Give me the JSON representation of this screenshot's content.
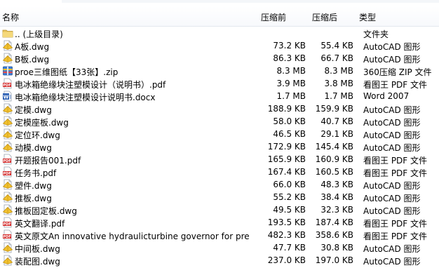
{
  "header": {
    "name": "名称",
    "size_before": "压缩前",
    "size_after": "压缩后",
    "type": "类型"
  },
  "files": [
    {
      "name": ".. (上级目录)",
      "icon": "folder-up-icon",
      "before": "",
      "after": "",
      "type": "文件夹"
    },
    {
      "name": "A板.dwg",
      "icon": "dwg-icon",
      "before": "73.2 KB",
      "after": "55.4 KB",
      "type": "AutoCAD 图形"
    },
    {
      "name": "B板.dwg",
      "icon": "dwg-icon",
      "before": "86.3 KB",
      "after": "66.7 KB",
      "type": "AutoCAD 图形"
    },
    {
      "name": "proe三维图纸【33张】.zip",
      "icon": "zip-icon",
      "before": "8.3 MB",
      "after": "8.3 MB",
      "type": "360压缩 ZIP 文件"
    },
    {
      "name": "电冰箱绝缘块注塑模设计（说明书）.pdf",
      "icon": "pdf-icon",
      "before": "3.9 MB",
      "after": "3.8 MB",
      "type": "看图王 PDF 文件"
    },
    {
      "name": "电冰箱绝缘块注塑模设计说明书.docx",
      "icon": "docx-icon",
      "before": "1.7 MB",
      "after": "1.7 MB",
      "type": "Word 2007"
    },
    {
      "name": "定模.dwg",
      "icon": "dwg-icon",
      "before": "188.9 KB",
      "after": "159.9 KB",
      "type": "AutoCAD 图形"
    },
    {
      "name": "定模座板.dwg",
      "icon": "dwg-icon",
      "before": "58.0 KB",
      "after": "40.7 KB",
      "type": "AutoCAD 图形"
    },
    {
      "name": "定位环.dwg",
      "icon": "dwg-icon",
      "before": "46.5 KB",
      "after": "29.1 KB",
      "type": "AutoCAD 图形"
    },
    {
      "name": "动模.dwg",
      "icon": "dwg-icon",
      "before": "172.9 KB",
      "after": "145.4 KB",
      "type": "AutoCAD 图形"
    },
    {
      "name": "开题报告001.pdf",
      "icon": "pdf-icon",
      "before": "165.9 KB",
      "after": "160.9 KB",
      "type": "看图王 PDF 文件"
    },
    {
      "name": "任务书.pdf",
      "icon": "pdf-icon",
      "before": "167.4 KB",
      "after": "160.5 KB",
      "type": "看图王 PDF 文件"
    },
    {
      "name": "塑件.dwg",
      "icon": "dwg-icon",
      "before": "66.0 KB",
      "after": "48.3 KB",
      "type": "AutoCAD 图形"
    },
    {
      "name": "推板.dwg",
      "icon": "dwg-icon",
      "before": "55.2 KB",
      "after": "38.4 KB",
      "type": "AutoCAD 图形"
    },
    {
      "name": "推板固定板.dwg",
      "icon": "dwg-icon",
      "before": "49.5 KB",
      "after": "32.3 KB",
      "type": "AutoCAD 图形"
    },
    {
      "name": "英文翻译.pdf",
      "icon": "pdf-icon",
      "before": "193.5 KB",
      "after": "187.4 KB",
      "type": "看图王 PDF 文件"
    },
    {
      "name": "英文原文An innovative hydraulicturbine governor for predi...",
      "icon": "pdf-icon",
      "before": "482.3 KB",
      "after": "358.6 KB",
      "type": "看图王 PDF 文件"
    },
    {
      "name": "中间板.dwg",
      "icon": "dwg-icon",
      "before": "47.7 KB",
      "after": "30.8 KB",
      "type": "AutoCAD 图形"
    },
    {
      "name": "装配图.dwg",
      "icon": "dwg-icon",
      "before": "237.0 KB",
      "after": "197.0 KB",
      "type": "AutoCAD 图形"
    }
  ]
}
